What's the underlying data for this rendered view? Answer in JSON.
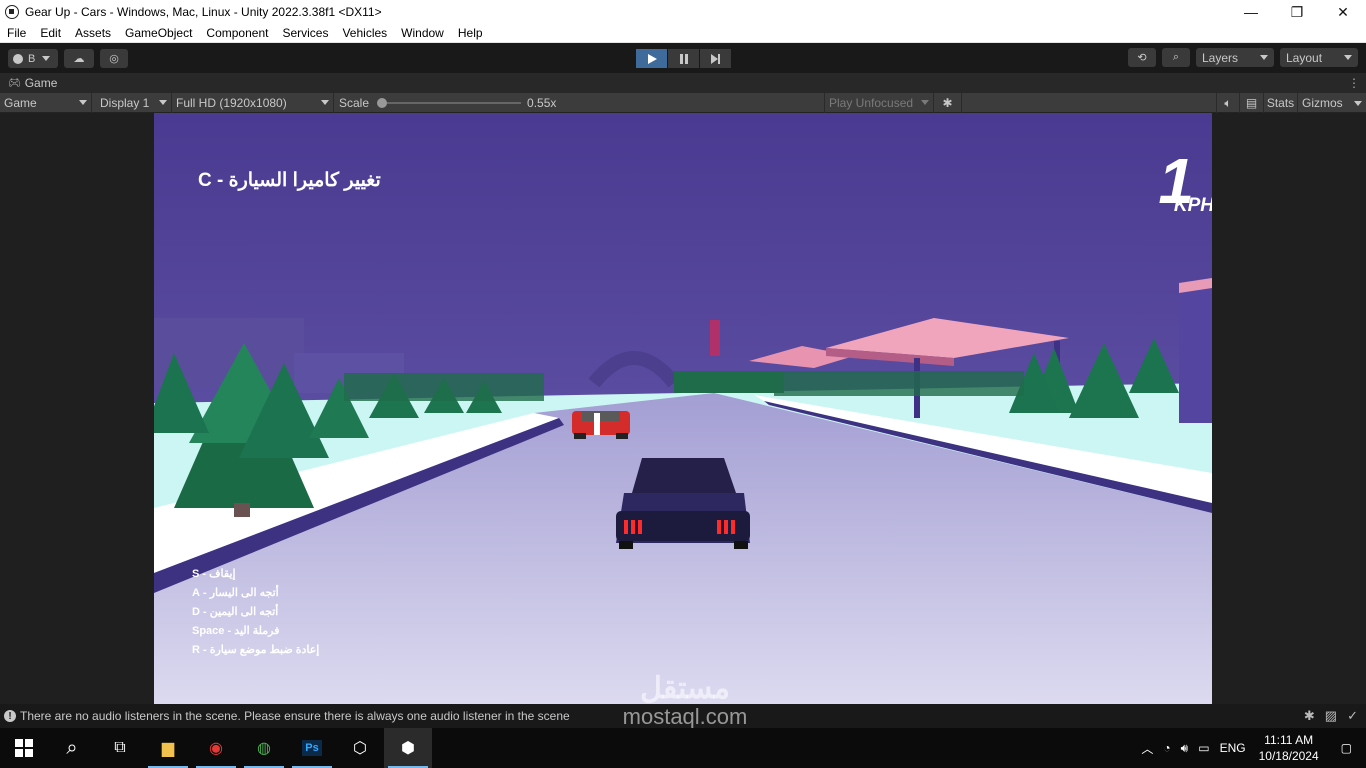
{
  "window": {
    "title": "Gear Up - Cars - Windows, Mac, Linux - Unity 2022.3.38f1 <DX11>",
    "minimize": "—",
    "maximize": "❐",
    "close": "✕"
  },
  "menu": [
    "File",
    "Edit",
    "Assets",
    "GameObject",
    "Component",
    "Services",
    "Vehicles",
    "Window",
    "Help"
  ],
  "toolbar": {
    "account_label": "B",
    "layers_label": "Layers",
    "layout_label": "Layout",
    "play_state": "playing"
  },
  "tab": {
    "label": "Game"
  },
  "gamebar": {
    "mode": "Game",
    "display": "Display 1",
    "resolution": "Full HD (1920x1080)",
    "scale_label": "Scale",
    "scale_value": "0.55x",
    "play_focus": "Play Unfocused",
    "stats": "Stats",
    "gizmos": "Gizmos"
  },
  "game": {
    "camera_hint": "تغيير كاميرا السيارة - C",
    "speed_value": "1",
    "speed_unit": "KPH",
    "controls": [
      "إيقاف - S",
      "أتجه الى اليسار - A",
      "أتجه الى اليمين - D",
      "فرملة اليد - Space",
      "إعادة ضبط موضع سيارة - R"
    ]
  },
  "status": {
    "message": "There are no audio listeners in the scene. Please ensure there is always one audio listener in the scene"
  },
  "watermark": {
    "arabic": "مستقل",
    "latin": "mostaql.com"
  },
  "taskbar": {
    "language": "ENG",
    "time": "11:11 AM",
    "date": "10/18/2024"
  }
}
